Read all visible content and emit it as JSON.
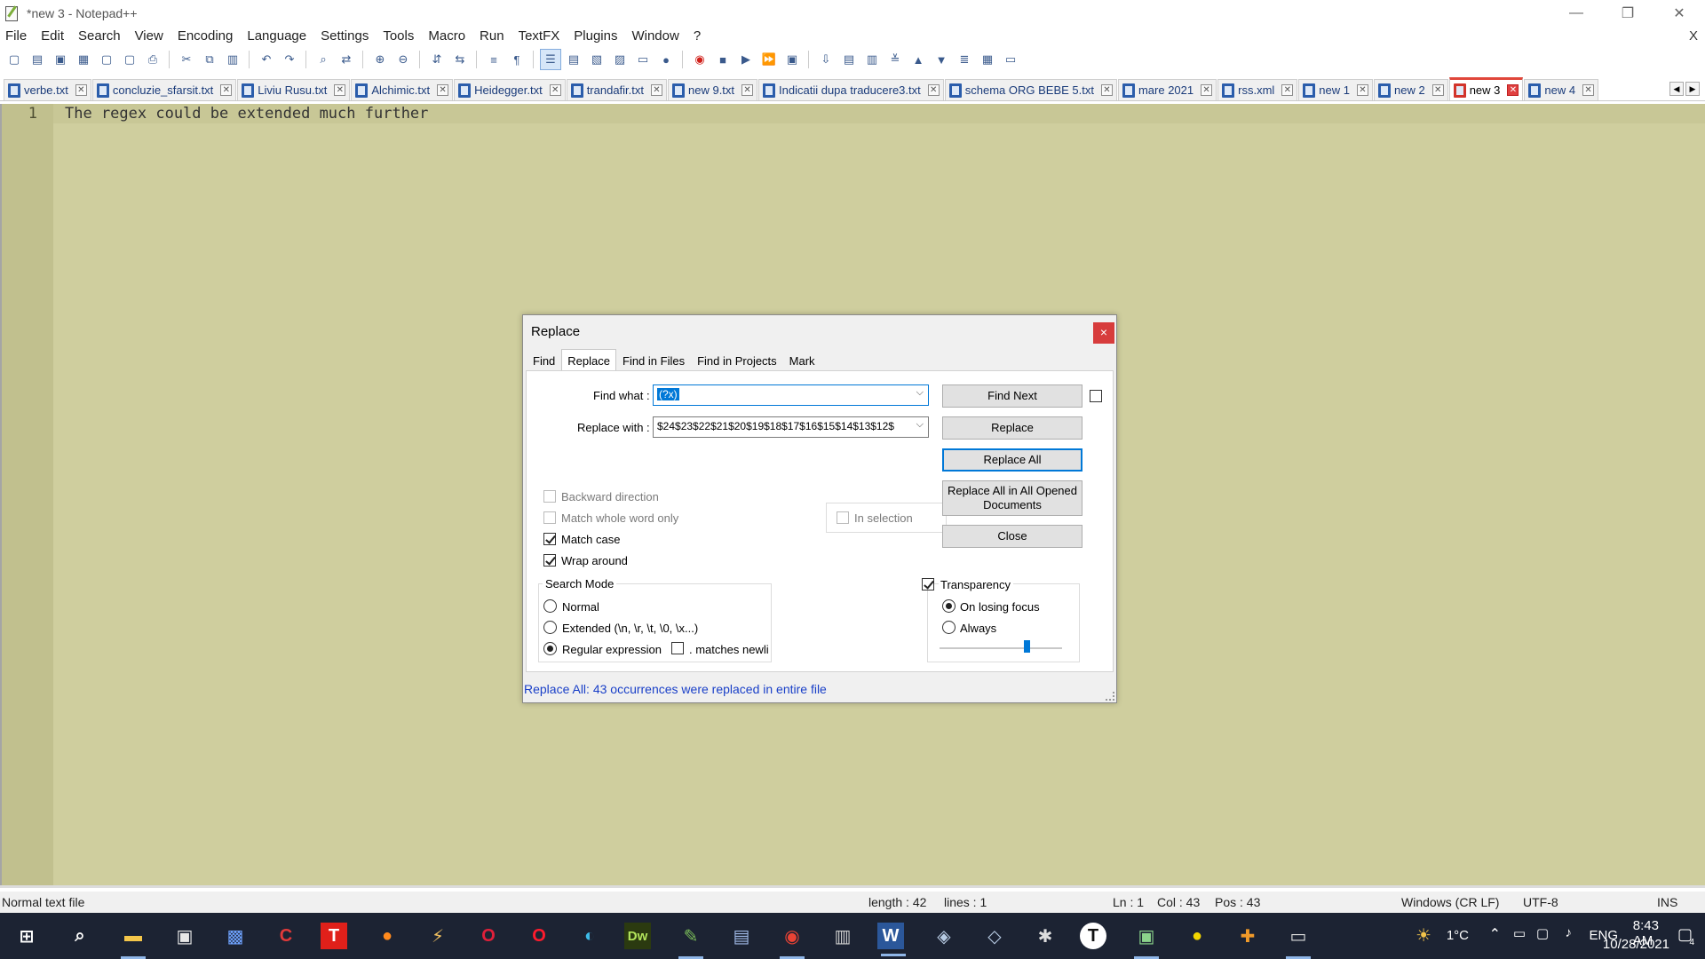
{
  "window": {
    "title": "*new 3 - Notepad++",
    "minimize": "—",
    "maximize": "❐",
    "close": "✕"
  },
  "menu": [
    "File",
    "Edit",
    "Search",
    "View",
    "Encoding",
    "Language",
    "Settings",
    "Tools",
    "Macro",
    "Run",
    "TextFX",
    "Plugins",
    "Window",
    "?"
  ],
  "menu_close": "X",
  "tabs": [
    {
      "label": "verbe.txt",
      "active": false
    },
    {
      "label": "concluzie_sfarsit.txt",
      "active": false
    },
    {
      "label": "Liviu Rusu.txt",
      "active": false
    },
    {
      "label": "Alchimic.txt",
      "active": false
    },
    {
      "label": "Heidegger.txt",
      "active": false
    },
    {
      "label": "trandafir.txt",
      "active": false
    },
    {
      "label": "new 9.txt",
      "active": false
    },
    {
      "label": "Indicatii dupa traducere3.txt",
      "active": false
    },
    {
      "label": "schema ORG BEBE 5.txt",
      "active": false
    },
    {
      "label": "mare 2021",
      "active": false
    },
    {
      "label": "rss.xml",
      "active": false
    },
    {
      "label": "new 1",
      "active": false
    },
    {
      "label": "new 2",
      "active": false
    },
    {
      "label": "new 3",
      "active": true
    },
    {
      "label": "new 4",
      "active": false
    }
  ],
  "editor": {
    "line_number": "1",
    "text": "The regex could be extended much further"
  },
  "dialog": {
    "title": "Replace",
    "close": "×",
    "tabs": [
      "Find",
      "Replace",
      "Find in Files",
      "Find in Projects",
      "Mark"
    ],
    "active_tab": "Replace",
    "find_what_label": "Find what :",
    "find_what_value": "(?x)",
    "replace_with_label": "Replace with :",
    "replace_with_value": "$24$23$22$21$20$19$18$17$16$15$14$13$12$",
    "buttons": {
      "find_next": "Find Next",
      "replace": "Replace",
      "replace_all": "Replace All",
      "replace_all_opened": "Replace All in All Opened Documents",
      "close": "Close"
    },
    "in_selection": "In selection",
    "options": {
      "backward": "Backward direction",
      "whole_word": "Match whole word only",
      "match_case": "Match case",
      "wrap_around": "Wrap around"
    },
    "search_mode": {
      "title": "Search Mode",
      "normal": "Normal",
      "extended": "Extended (\\n, \\r, \\t, \\0, \\x...)",
      "regex": "Regular expression",
      "matches_newline": ". matches newline",
      "selected": "regex"
    },
    "transparency": {
      "title": "Transparency",
      "on_losing_focus": "On losing focus",
      "always": "Always",
      "level": 0.7
    },
    "status": "Replace All: 43 occurrences were replaced in entire file"
  },
  "statusbar": {
    "type": "Normal text file",
    "length": "length : 42",
    "lines": "lines : 1",
    "ln": "Ln : 1",
    "col": "Col : 43",
    "pos": "Pos : 43",
    "eol": "Windows (CR LF)",
    "encoding": "UTF-8",
    "mode": "INS"
  },
  "taskbar": {
    "weather": "1°C",
    "lang": "ENG",
    "time": "8:43 AM",
    "date": "10/28/2021",
    "notifications": "4"
  },
  "colors": {
    "editor_bg": "#cfce9e",
    "gutter_bg": "#c1c08e",
    "taskbar_bg": "#1c2333",
    "accent": "#0078d7",
    "status_text": "#1a40c8"
  }
}
